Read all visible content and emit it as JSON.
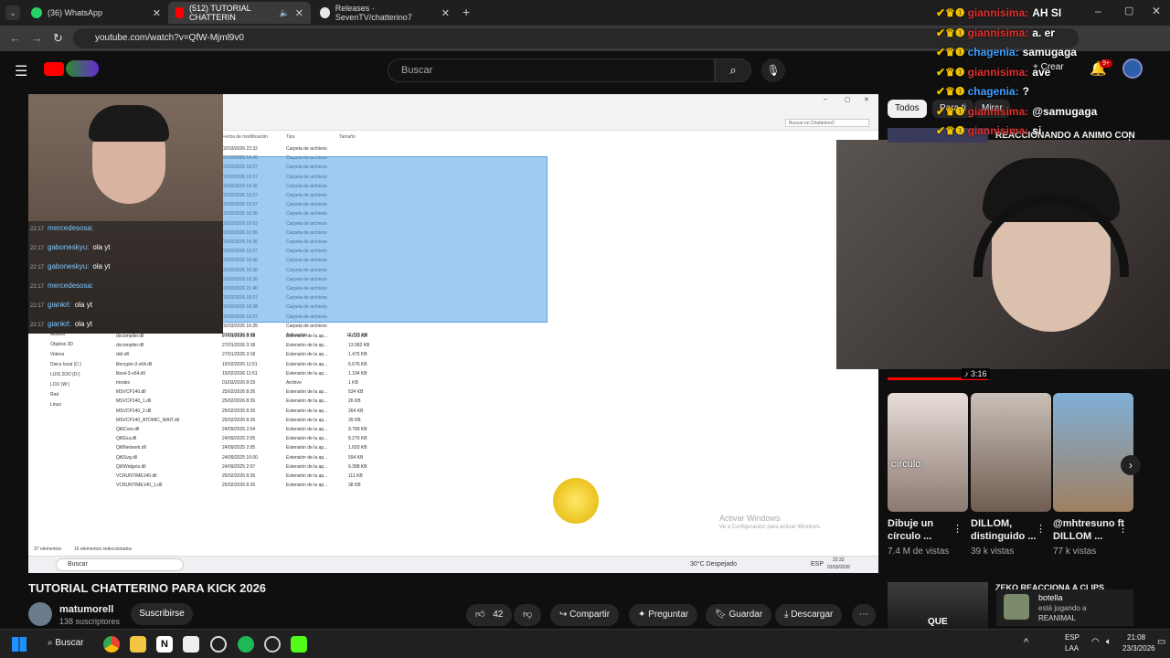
{
  "browser": {
    "tabs": [
      {
        "label": "(36) WhatsApp"
      },
      {
        "label": "(512) TUTORIAL CHATTERIN"
      },
      {
        "label": "Releases · SevenTV/chatterino7"
      }
    ],
    "url": "youtube.com/watch?v=QfW-Mjml9v0"
  },
  "youtube": {
    "search_placeholder": "Buscar",
    "create_label": "Crear",
    "notifications_badge": "9+",
    "filter_chips": [
      "Todos",
      "Para ti",
      "Mirar"
    ],
    "video_title": "TUTORIAL CHATTERINO PARA KICK 2026",
    "channel_name": "matumorell",
    "subscribers": "138 suscriptores",
    "subscribe_label": "Suscribirse",
    "likes": "42",
    "share_label": "Compartir",
    "ask_label": "Preguntar",
    "save_label": "Guardar",
    "download_label": "Descargar",
    "rec_title": "REACCIONANDO A ANIMO CON",
    "rec_duration": "3:16",
    "shorts": [
      {
        "title": "Dibuje un círculo ...",
        "views": "7.4 M de vistas",
        "overlay": "círculo"
      },
      {
        "title": "DILLOM, distinguido ...",
        "views": "39 k vistas"
      },
      {
        "title": "@mhtresuno ft DILLOM ...",
        "views": "77 k vistas"
      }
    ],
    "bottom_rec_title": "ZEKO REACCIONA A CLIPS",
    "bottom_rec_overlay": "QUE",
    "presence": {
      "name": "botella",
      "status": "está jugando a",
      "game": "REANIMAL"
    }
  },
  "stream_chat": [
    {
      "user": "giannisima:",
      "msg": "AH SI"
    },
    {
      "user": "giannisima:",
      "msg": "a. er"
    },
    {
      "user": "chagenia:",
      "msg": "samugaga"
    },
    {
      "user": "giannisima:",
      "msg": "ave"
    },
    {
      "user": "chagenia:",
      "msg": "?"
    },
    {
      "user": "giannisima:",
      "msg": "@samugaga"
    },
    {
      "user": "giannisima:",
      "msg": "si"
    }
  ],
  "overlay_chat": [
    {
      "time": "22:17",
      "user": "mercedesosa:",
      "msg": ""
    },
    {
      "time": "22:17",
      "user": "gaboneskyu:",
      "msg": "ola yt"
    },
    {
      "time": "22:17",
      "user": "gaboneskyu:",
      "msg": "ola yt"
    },
    {
      "time": "22:17",
      "user": "mercedesosa:",
      "msg": ""
    },
    {
      "time": "22:17",
      "user": "giankrl:",
      "msg": "ola yt"
    },
    {
      "time": "22:17",
      "user": "giankrl:",
      "msg": "ola yt"
    }
  ],
  "explorer": {
    "search_placeholder": "Buscar en Chatterino2",
    "col_headers": [
      "Fecha de modificación",
      "Tipo",
      "Tamaño"
    ],
    "folder_rows": [
      {
        "date": "02/03/2026 22:32",
        "type": "Carpeta de archivos",
        "size": ""
      },
      {
        "date": "02/03/2026 16:45",
        "type": "Carpeta de archivos",
        "size": ""
      },
      {
        "date": "02/03/2026 16:37",
        "type": "Carpeta de archivos",
        "size": ""
      },
      {
        "date": "02/03/2026 16:37",
        "type": "Carpeta de archivos",
        "size": ""
      },
      {
        "date": "02/03/2026 16:36",
        "type": "Carpeta de archivos",
        "size": ""
      },
      {
        "date": "02/03/2026 16:37",
        "type": "Carpeta de archivos",
        "size": ""
      },
      {
        "date": "02/03/2026 16:37",
        "type": "Carpeta de archivos",
        "size": ""
      },
      {
        "date": "02/03/2026 16:36",
        "type": "Carpeta de archivos",
        "size": ""
      },
      {
        "date": "02/03/2026 16:03",
        "type": "Carpeta de archivos",
        "size": ""
      },
      {
        "date": "02/03/2026 16:36",
        "type": "Carpeta de archivos",
        "size": ""
      },
      {
        "date": "02/03/2026 16:36",
        "type": "Carpeta de archivos",
        "size": ""
      },
      {
        "date": "02/03/2026 16:37",
        "type": "Carpeta de archivos",
        "size": ""
      },
      {
        "date": "02/03/2026 16:36",
        "type": "Carpeta de archivos",
        "size": ""
      },
      {
        "date": "02/03/2026 16:36",
        "type": "Carpeta de archivos",
        "size": ""
      },
      {
        "date": "02/03/2026 16:36",
        "type": "Carpeta de archivos",
        "size": ""
      },
      {
        "date": "02/03/2026 21:40",
        "type": "Carpeta de archivos",
        "size": ""
      },
      {
        "date": "02/03/2026 16:37",
        "type": "Carpeta de archivos",
        "size": ""
      },
      {
        "date": "02/03/2026 16:38",
        "type": "Carpeta de archivos",
        "size": ""
      },
      {
        "date": "02/03/2026 16:37",
        "type": "Carpeta de archivos",
        "size": ""
      },
      {
        "date": "02/03/2026 16:35",
        "type": "Carpeta de archivos",
        "size": ""
      },
      {
        "date": "01/03/2026 8:48",
        "type": "Aplicación",
        "size": "13.725 KB"
      }
    ],
    "file_rows": [
      {
        "name": "dxcompiler.dll",
        "date": "27/01/2026 3:18",
        "type": "Extensión de la ap...",
        "size": "4.631 KB"
      },
      {
        "name": "dxcompiler.dll",
        "date": "27/01/2026 3:18",
        "type": "Extensión de la ap...",
        "size": "13.982 KB"
      },
      {
        "name": "dxil.dll",
        "date": "27/01/2026 3:18",
        "type": "Extensión de la ap...",
        "size": "1.475 KB"
      },
      {
        "name": "libcrypto-3-x64.dll",
        "date": "15/02/2026 11:51",
        "type": "Extensión de la ap...",
        "size": "6.676 KB"
      },
      {
        "name": "libssl-3-x64.dll",
        "date": "15/02/2026 11:51",
        "type": "Extensión de la ap...",
        "size": "1.194 KB"
      },
      {
        "name": "modes",
        "date": "01/03/2026 8:29",
        "type": "Archivo",
        "size": "1 KB"
      },
      {
        "name": "MSVCP140.dll",
        "date": "25/02/2026 8:26",
        "type": "Extensión de la ap...",
        "size": "534 KB"
      },
      {
        "name": "MSVCP140_1.dll",
        "date": "25/02/2026 8:26",
        "type": "Extensión de la ap...",
        "size": "26 KB"
      },
      {
        "name": "MSVCP140_2.dll",
        "date": "25/02/2026 8:26",
        "type": "Extensión de la ap...",
        "size": "264 KB"
      },
      {
        "name": "MSVCP140_ATOMIC_WAIT.dll",
        "date": "25/02/2026 8:26",
        "type": "Extensión de la ap...",
        "size": "39 KB"
      },
      {
        "name": "Qt6Core.dll",
        "date": "24/09/2025 2:04",
        "type": "Extensión de la ap...",
        "size": "9.789 KB"
      },
      {
        "name": "Qt6Gui.dll",
        "date": "24/09/2025 2:05",
        "type": "Extensión de la ap...",
        "size": "8.275 KB"
      },
      {
        "name": "Qt6Network.dll",
        "date": "24/09/2025 2:05",
        "type": "Extensión de la ap...",
        "size": "1.693 KB"
      },
      {
        "name": "Qt6Svg.dll",
        "date": "24/09/2025 16:00",
        "type": "Extensión de la ap...",
        "size": "594 KB"
      },
      {
        "name": "Qt6Widgets.dll",
        "date": "24/09/2025 2:07",
        "type": "Extensión de la ap...",
        "size": "6.388 KB"
      },
      {
        "name": "VCRUNTIME140.dll",
        "date": "25/02/2026 8:26",
        "type": "Extensión de la ap...",
        "size": "111 KB"
      },
      {
        "name": "VCRUNTIME140_1.dll",
        "date": "25/02/2026 8:26",
        "type": "Extensión de la ap...",
        "size": "38 KB"
      }
    ],
    "nav_items": [
      "Música",
      "Objetos 3D",
      "Videos",
      "Disco local (C:)",
      "LUIS 2DO (D:)",
      "LOU (W:)",
      "Red",
      "Linux"
    ],
    "status_count": "37 elementos",
    "status_selected": "15 elementos seleccionados",
    "watermark_title": "Activar Windows",
    "watermark_sub": "Ve a Configuración para activar Windows."
  },
  "inner_taskbar": {
    "search": "Buscar",
    "weather": "30°C  Despejado",
    "lang": "ESP",
    "time": "22:33",
    "date": "02/03/2026"
  },
  "taskbar": {
    "search_label": "Buscar",
    "lang": "ESP",
    "lang2": "LAA",
    "time": "21:08",
    "date": "23/3/2026"
  },
  "colors": {
    "accent_red": "#ff0000",
    "chat_blue": "#3fa0ff",
    "chat_red": "#e03030",
    "selection_blue": "#5aa0e0"
  }
}
